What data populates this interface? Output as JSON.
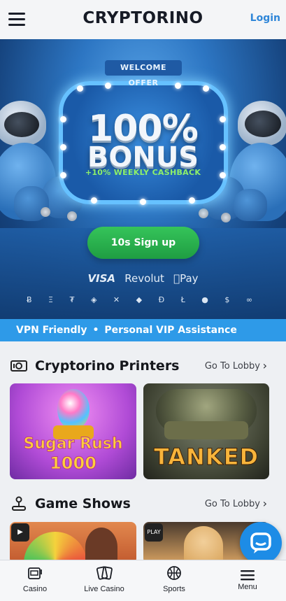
{
  "header": {
    "logo": "CRYPTORINO",
    "login_label": "Login"
  },
  "hero": {
    "ribbon": "WELCOME OFFER",
    "bonus_line1": "100%",
    "bonus_line2": "BONUS",
    "cashback": "+10% WEEKLY CASHBACK",
    "signup_label": "10s Sign up",
    "payments": [
      "VISA",
      "Revolut",
      "Pay"
    ],
    "crypto_icons": "Ƀ Ξ ₮ ◈ ✕ ◆ Đ Ł ● $ ∞"
  },
  "banner": {
    "item1": "VPN Friendly",
    "separator": "•",
    "item2": "Personal VIP Assistance"
  },
  "sections": {
    "printers": {
      "title": "Cryptorino Printers",
      "lobby_label": "Go To Lobby",
      "games": [
        {
          "name_line1": "Sugar Rush",
          "name_line2": "1000"
        },
        {
          "name": "TANKED"
        }
      ]
    },
    "game_shows": {
      "title": "Game Shows",
      "lobby_label": "Go To Lobby",
      "badge2": "PLAY"
    }
  },
  "bottom_nav": {
    "items": [
      {
        "label": "Casino",
        "icon": "slot-machine-icon"
      },
      {
        "label": "Live Casino",
        "icon": "live-cards-icon"
      },
      {
        "label": "Sports",
        "icon": "basketball-icon"
      },
      {
        "label": "Menu",
        "icon": "menu-icon"
      }
    ]
  },
  "colors": {
    "accent": "#2e9ae8",
    "login": "#2f86d8",
    "signup": "#27ae4a",
    "cashback": "#8ef06a"
  }
}
